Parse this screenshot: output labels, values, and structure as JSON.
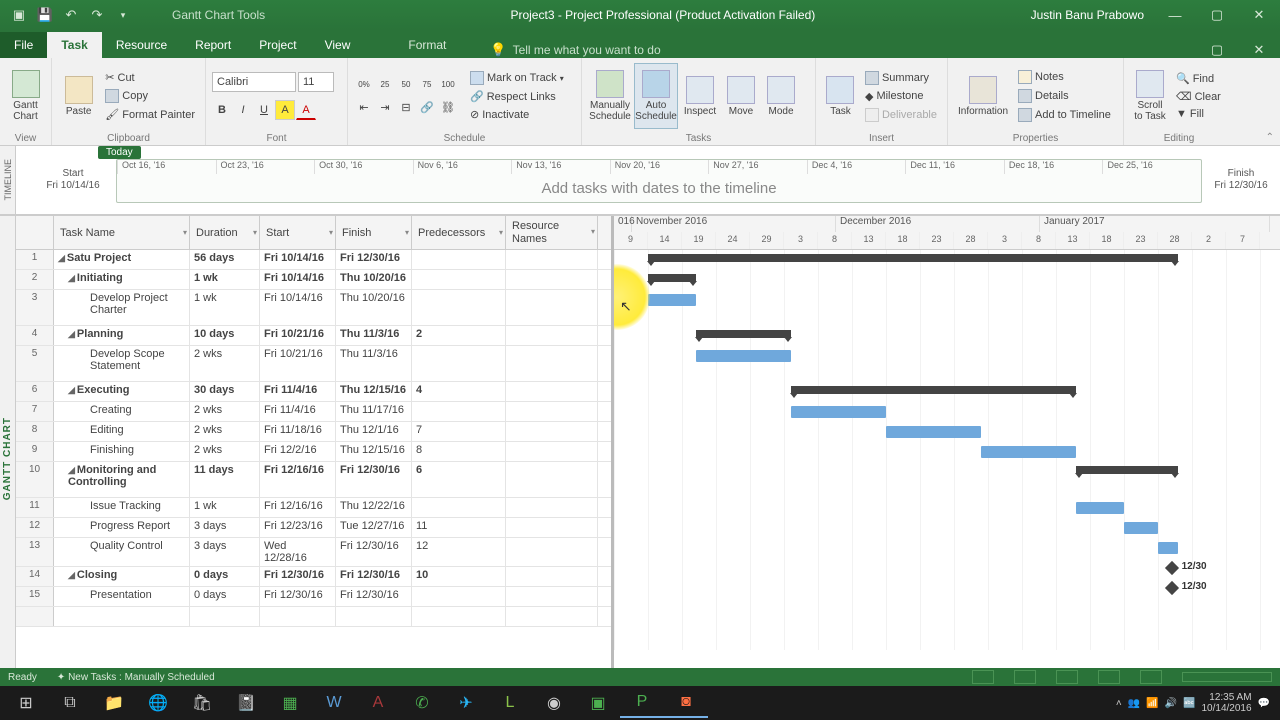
{
  "titlebar": {
    "tools_label": "Gantt Chart Tools",
    "title": "Project3 - Project Professional (Product Activation Failed)",
    "user": "Justin Banu Prabowo"
  },
  "ribbon_tabs": {
    "file": "File",
    "task": "Task",
    "resource": "Resource",
    "report": "Report",
    "project": "Project",
    "view": "View",
    "format": "Format",
    "tell_me": "Tell me what you want to do"
  },
  "ribbon": {
    "view": {
      "label": "View",
      "gantt": "Gantt\nChart"
    },
    "clipboard": {
      "label": "Clipboard",
      "paste": "Paste",
      "cut": "Cut",
      "copy": "Copy",
      "format_painter": "Format Painter"
    },
    "font": {
      "label": "Font",
      "name": "Calibri",
      "size": "11"
    },
    "schedule": {
      "label": "Schedule",
      "mark_on_track": "Mark on Track",
      "respect_links": "Respect Links",
      "inactivate": "Inactivate"
    },
    "tasks": {
      "label": "Tasks",
      "manual": "Manually\nSchedule",
      "auto": "Auto\nSchedule",
      "inspect": "Inspect",
      "move": "Move",
      "mode": "Mode"
    },
    "insert": {
      "label": "Insert",
      "task": "Task",
      "summary": "Summary",
      "milestone": "Milestone",
      "deliverable": "Deliverable"
    },
    "properties": {
      "label": "Properties",
      "information": "Information",
      "notes": "Notes",
      "details": "Details",
      "add_timeline": "Add to Timeline"
    },
    "editing": {
      "label": "Editing",
      "scroll": "Scroll\nto Task",
      "find": "Find",
      "clear": "Clear",
      "fill": "Fill"
    }
  },
  "timeline": {
    "panel": "TIMELINE",
    "today": "Today",
    "start_label": "Start",
    "start_date": "Fri 10/14/16",
    "finish_label": "Finish",
    "finish_date": "Fri 12/30/16",
    "placeholder": "Add tasks with dates to the timeline",
    "dates": [
      "Oct 16, '16",
      "Oct 23, '16",
      "Oct 30, '16",
      "Nov 6, '16",
      "Nov 13, '16",
      "Nov 20, '16",
      "Nov 27, '16",
      "Dec 4, '16",
      "Dec 11, '16",
      "Dec 18, '16",
      "Dec 25, '16"
    ]
  },
  "grid": {
    "panel": "GANTT CHART",
    "headers": {
      "task": "Task Name",
      "duration": "Duration",
      "start": "Start",
      "finish": "Finish",
      "pred": "Predecessors",
      "res": "Resource\nNames"
    },
    "rows": [
      {
        "n": 1,
        "name": "Satu Project",
        "dur": "56 days",
        "start": "Fri 10/14/16",
        "finish": "Fri 12/30/16",
        "pred": "",
        "lvl": 0,
        "sum": true
      },
      {
        "n": 2,
        "name": "Initiating",
        "dur": "1 wk",
        "start": "Fri 10/14/16",
        "finish": "Thu 10/20/16",
        "pred": "",
        "lvl": 1,
        "sum": true
      },
      {
        "n": 3,
        "name": "Develop Project Charter",
        "dur": "1 wk",
        "start": "Fri 10/14/16",
        "finish": "Thu 10/20/16",
        "pred": "",
        "lvl": 2,
        "tall": true
      },
      {
        "n": 4,
        "name": "Planning",
        "dur": "10 days",
        "start": "Fri 10/21/16",
        "finish": "Thu 11/3/16",
        "pred": "2",
        "lvl": 1,
        "sum": true
      },
      {
        "n": 5,
        "name": "Develop Scope Statement",
        "dur": "2 wks",
        "start": "Fri 10/21/16",
        "finish": "Thu 11/3/16",
        "pred": "",
        "lvl": 2,
        "tall": true
      },
      {
        "n": 6,
        "name": "Executing",
        "dur": "30 days",
        "start": "Fri 11/4/16",
        "finish": "Thu 12/15/16",
        "pred": "4",
        "lvl": 1,
        "sum": true
      },
      {
        "n": 7,
        "name": "Creating",
        "dur": "2 wks",
        "start": "Fri 11/4/16",
        "finish": "Thu 11/17/16",
        "pred": "",
        "lvl": 2
      },
      {
        "n": 8,
        "name": "Editing",
        "dur": "2 wks",
        "start": "Fri 11/18/16",
        "finish": "Thu 12/1/16",
        "pred": "7",
        "lvl": 2
      },
      {
        "n": 9,
        "name": "Finishing",
        "dur": "2 wks",
        "start": "Fri 12/2/16",
        "finish": "Thu 12/15/16",
        "pred": "8",
        "lvl": 2
      },
      {
        "n": 10,
        "name": "Monitoring and Controlling",
        "dur": "11 days",
        "start": "Fri 12/16/16",
        "finish": "Fri 12/30/16",
        "pred": "6",
        "lvl": 1,
        "sum": true,
        "tall": true
      },
      {
        "n": 11,
        "name": "Issue Tracking",
        "dur": "1 wk",
        "start": "Fri 12/16/16",
        "finish": "Thu 12/22/16",
        "pred": "",
        "lvl": 2
      },
      {
        "n": 12,
        "name": "Progress Report",
        "dur": "3 days",
        "start": "Fri 12/23/16",
        "finish": "Tue 12/27/16",
        "pred": "11",
        "lvl": 2
      },
      {
        "n": 13,
        "name": "Quality Control",
        "dur": "3 days",
        "start": "Wed 12/28/16",
        "finish": "Fri 12/30/16",
        "pred": "12",
        "lvl": 2
      },
      {
        "n": 14,
        "name": "Closing",
        "dur": "0 days",
        "start": "Fri 12/30/16",
        "finish": "Fri 12/30/16",
        "pred": "10",
        "lvl": 1,
        "sum": true
      },
      {
        "n": 15,
        "name": "Presentation",
        "dur": "0 days",
        "start": "Fri 12/30/16",
        "finish": "Fri 12/30/16",
        "pred": "",
        "lvl": 2
      }
    ]
  },
  "gantt_header": {
    "month_frag": "016",
    "months": [
      "November 2016",
      "December 2016",
      "January 2017"
    ],
    "days": [
      "9",
      "14",
      "19",
      "24",
      "29",
      "3",
      "8",
      "13",
      "18",
      "23",
      "28",
      "3",
      "8",
      "13",
      "18",
      "23",
      "28",
      "2",
      "7"
    ]
  },
  "milestone_labels": {
    "m14": "12/30",
    "m15": "12/30"
  },
  "chart_data": {
    "type": "gantt",
    "time_axis": {
      "start": "2016-10-09",
      "end": "2017-01-07",
      "major_unit": "week"
    },
    "tasks": [
      {
        "id": 1,
        "name": "Satu Project",
        "type": "summary",
        "start": "2016-10-14",
        "finish": "2016-12-30"
      },
      {
        "id": 2,
        "name": "Initiating",
        "type": "summary",
        "start": "2016-10-14",
        "finish": "2016-10-20"
      },
      {
        "id": 3,
        "name": "Develop Project Charter",
        "type": "task",
        "start": "2016-10-14",
        "finish": "2016-10-20"
      },
      {
        "id": 4,
        "name": "Planning",
        "type": "summary",
        "start": "2016-10-21",
        "finish": "2016-11-03",
        "pred": [
          2
        ]
      },
      {
        "id": 5,
        "name": "Develop Scope Statement",
        "type": "task",
        "start": "2016-10-21",
        "finish": "2016-11-03"
      },
      {
        "id": 6,
        "name": "Executing",
        "type": "summary",
        "start": "2016-11-04",
        "finish": "2016-12-15",
        "pred": [
          4
        ]
      },
      {
        "id": 7,
        "name": "Creating",
        "type": "task",
        "start": "2016-11-04",
        "finish": "2016-11-17"
      },
      {
        "id": 8,
        "name": "Editing",
        "type": "task",
        "start": "2016-11-18",
        "finish": "2016-12-01",
        "pred": [
          7
        ]
      },
      {
        "id": 9,
        "name": "Finishing",
        "type": "task",
        "start": "2016-12-02",
        "finish": "2016-12-15",
        "pred": [
          8
        ]
      },
      {
        "id": 10,
        "name": "Monitoring and Controlling",
        "type": "summary",
        "start": "2016-12-16",
        "finish": "2016-12-30",
        "pred": [
          6
        ]
      },
      {
        "id": 11,
        "name": "Issue Tracking",
        "type": "task",
        "start": "2016-12-16",
        "finish": "2016-12-22"
      },
      {
        "id": 12,
        "name": "Progress Report",
        "type": "task",
        "start": "2016-12-23",
        "finish": "2016-12-27",
        "pred": [
          11
        ]
      },
      {
        "id": 13,
        "name": "Quality Control",
        "type": "task",
        "start": "2016-12-28",
        "finish": "2016-12-30",
        "pred": [
          12
        ]
      },
      {
        "id": 14,
        "name": "Closing",
        "type": "milestone",
        "start": "2016-12-30",
        "finish": "2016-12-30",
        "pred": [
          10
        ]
      },
      {
        "id": 15,
        "name": "Presentation",
        "type": "milestone",
        "start": "2016-12-30",
        "finish": "2016-12-30"
      }
    ]
  },
  "statusbar": {
    "ready": "Ready",
    "new_tasks": "New Tasks : Manually Scheduled"
  },
  "taskbar": {
    "time": "12:35 AM",
    "date": "10/14/2016"
  }
}
